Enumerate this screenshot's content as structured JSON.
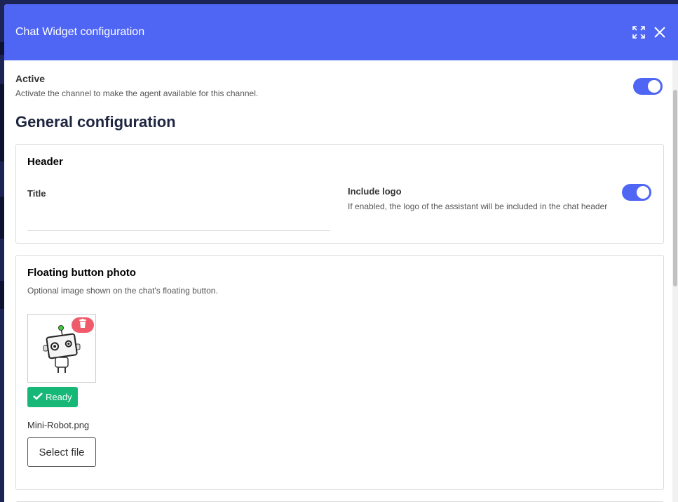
{
  "modal": {
    "title": "Chat Widget configuration",
    "expand_icon": "expand-icon",
    "close_icon": "close-icon"
  },
  "active": {
    "label": "Active",
    "help": "Activate the channel to make the agent available for this channel.",
    "enabled": true
  },
  "general": {
    "title": "General configuration"
  },
  "header_card": {
    "title": "Header",
    "title_field_label": "Title",
    "title_field_value": "",
    "include_logo_label": "Include logo",
    "include_logo_help": "If enabled, the logo of the assistant will be included in the chat header",
    "include_logo_enabled": true
  },
  "floating_card": {
    "title": "Floating button photo",
    "help": "Optional image shown on the chat's floating button.",
    "status": "Ready",
    "file_name": "Mini-Robot.png",
    "select_label": "Select file"
  },
  "colors": {
    "accent": "#4f66f5",
    "ready": "#17b877",
    "delete": "#ef5b6a"
  }
}
